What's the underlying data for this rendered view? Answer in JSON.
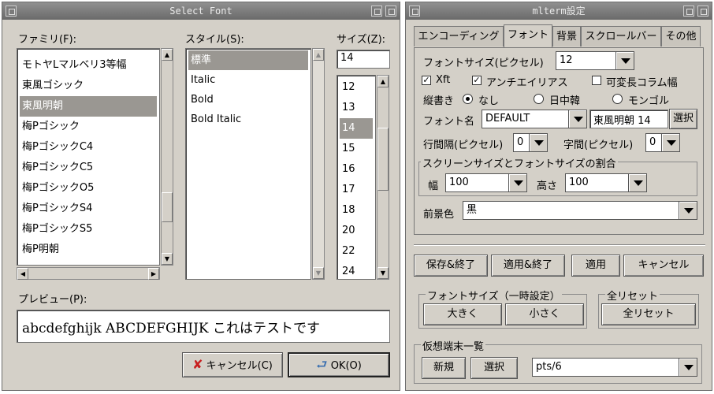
{
  "select_font": {
    "title": "Select Font",
    "family_label": "ファミリ(F):",
    "style_label": "スタイル(S):",
    "size_label": "サイズ(Z):",
    "families": [
      "モトヤLマルベリ3等幅",
      "東風ゴシック",
      "東風明朝",
      "梅Pゴシック",
      "梅PゴシックC4",
      "梅PゴシックC5",
      "梅PゴシックO5",
      "梅PゴシックS4",
      "梅PゴシックS5",
      "梅P明朝"
    ],
    "selected_family": "東風明朝",
    "styles": [
      "標準",
      "Italic",
      "Bold",
      "Bold Italic"
    ],
    "selected_style": "標準",
    "size_value": "14",
    "sizes": [
      "12",
      "13",
      "14",
      "15",
      "16",
      "17",
      "18",
      "20",
      "22",
      "24"
    ],
    "selected_size": "14",
    "preview_label": "プレビュー(P):",
    "preview_text": "abcdefghijk ABCDEFGHIJK これはテストです",
    "cancel_label": "キャンセル(C)",
    "ok_label": "OK(O)"
  },
  "mlterm": {
    "title": "mlterm設定",
    "tabs": [
      "エンコーディング",
      "フォント",
      "背景",
      "スクロールバー",
      "その他"
    ],
    "active_tab": "フォント",
    "font_size_label": "フォントサイズ(ピクセル)",
    "font_size_value": "12",
    "xft_label": "Xft",
    "antialias_label": "アンチエイリアス",
    "var_column_label": "可変長コラム幅",
    "vertical_label": "縦書き",
    "radio_none": "なし",
    "radio_cjk": "日中韓",
    "radio_mongol": "モンゴル",
    "font_name_label": "フォント名",
    "font_name_value": "DEFAULT",
    "font_name_field": "東風明朝 14",
    "select_label": "選択",
    "line_space_label": "行間隔(ピクセル)",
    "line_space_value": "0",
    "letter_space_label": "字間(ピクセル)",
    "letter_space_value": "0",
    "ratio_group": "スクリーンサイズとフォントサイズの割合",
    "width_label": "幅",
    "width_value": "100",
    "height_label": "高さ",
    "height_value": "100",
    "fg_label": "前景色",
    "fg_value": "黒",
    "save_exit": "保存&終了",
    "apply_exit": "適用&終了",
    "apply": "適用",
    "cancel": "キャンセル",
    "temp_font_group": "フォントサイズ（一時設定）",
    "larger": "大きく",
    "smaller": "小さく",
    "reset_group": "全リセット",
    "reset_button": "全リセット",
    "vt_group": "仮想端末一覧",
    "new_button": "新規",
    "select_button": "選択",
    "pty_value": "pts/6"
  },
  "colors": {
    "selection": "#9a9792",
    "window_bg": "#d4d0c8",
    "titlebar": "#7a7a7a"
  }
}
